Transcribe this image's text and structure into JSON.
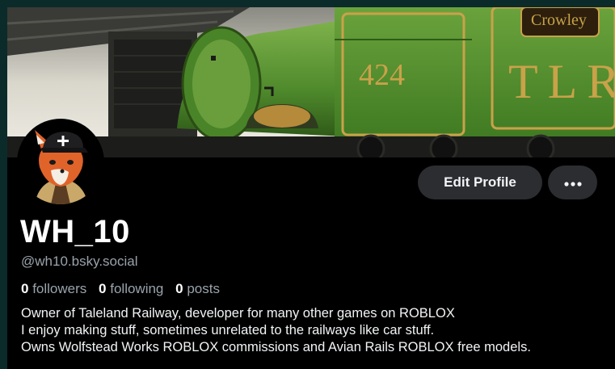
{
  "profile": {
    "display_name": "WH_10",
    "handle": "@wh10.bsky.social",
    "stats": {
      "followers_count": "0",
      "followers_label": "followers",
      "following_count": "0",
      "following_label": "following",
      "posts_count": "0",
      "posts_label": "posts"
    },
    "bio_lines": [
      "Owner of Taleland Railway, developer for many other games on ROBLOX",
      "I enjoy making stuff, sometimes unrelated to the railways like car stuff.",
      "Owns Wolfstead Works ROBLOX commissions and Avian Rails ROBLOX free models."
    ]
  },
  "actions": {
    "edit_profile_label": "Edit Profile",
    "more_icon": "more-horizontal-icon"
  },
  "banner": {
    "engine_number": "424",
    "tender_lettering": "TLR",
    "nameplate": "Crowley"
  },
  "colors": {
    "background": "#000000",
    "button_bg": "#2b2d31",
    "text_primary": "#ffffff",
    "text_secondary": "#9aa3ab",
    "locomotive_green": "#4e8f2a"
  }
}
